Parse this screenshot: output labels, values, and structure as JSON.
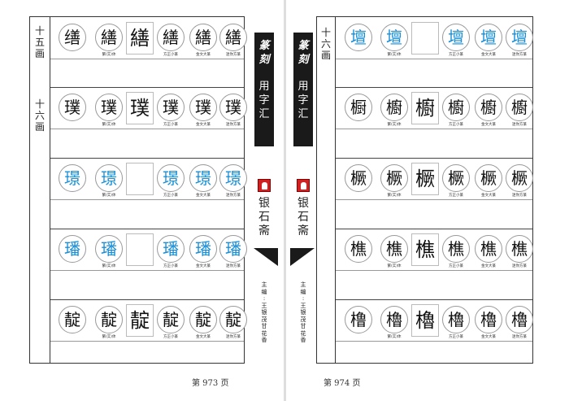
{
  "left": {
    "page_label": "第 973 页",
    "sections": [
      {
        "label": [
          "十",
          "五",
          "画"
        ]
      },
      {
        "label": [
          "十",
          "六",
          "画"
        ]
      }
    ],
    "rows": [
      {
        "chars": [
          "缮",
          "繕",
          "繕",
          "繕",
          "繕",
          "繕"
        ],
        "captions": [
          "繁(实)体",
          "方正小篆",
          "金文大篆",
          "迷你方篆"
        ],
        "blue": false
      },
      {
        "chars": [
          "璞",
          "璞",
          "璞",
          "璞",
          "璞",
          "璞"
        ],
        "captions": [
          "繁(实)体",
          "方正小篆",
          "金文大篆",
          "迷你方篆"
        ],
        "blue": false
      },
      {
        "chars": [
          "璟",
          "璟",
          "",
          "璟",
          "璟",
          "璟"
        ],
        "captions": [
          "繁(实)体",
          "方正小篆",
          "金文大篆",
          "迷你方篆"
        ],
        "blue": true
      },
      {
        "chars": [
          "璠",
          "璠",
          "",
          "璠",
          "璠",
          "璠"
        ],
        "captions": [
          "繁(实)体",
          "方正小篆",
          "金文大篆",
          "迷你方篆"
        ],
        "blue": true
      },
      {
        "chars": [
          "靛",
          "靛",
          "靛",
          "靛",
          "靛",
          "靛"
        ],
        "captions": [
          "繁(实)体",
          "方正小篆",
          "金文大篆",
          "迷你方篆"
        ],
        "blue": false
      }
    ]
  },
  "right": {
    "page_label": "第 974 页",
    "sections": [
      {
        "label": [
          "十",
          "六",
          "画"
        ]
      }
    ],
    "rows": [
      {
        "chars": [
          "壇",
          "壇",
          "",
          "壇",
          "壇",
          "壇"
        ],
        "captions": [
          "繁(实)体",
          "方正小篆",
          "金文大篆",
          "迷你方篆"
        ],
        "blue": true
      },
      {
        "chars": [
          "橱",
          "櫥",
          "櫥",
          "櫥",
          "櫥",
          "櫥"
        ],
        "captions": [
          "繁(实)体",
          "方正小篆",
          "金文大篆",
          "迷你方篆"
        ],
        "blue": false
      },
      {
        "chars": [
          "橛",
          "橛",
          "橛",
          "橛",
          "橛",
          "橛"
        ],
        "captions": [
          "繁(实)体",
          "方正小篆",
          "金文大篆",
          "迷你方篆"
        ],
        "blue": false
      },
      {
        "chars": [
          "樵",
          "樵",
          "樵",
          "樵",
          "樵",
          "樵"
        ],
        "captions": [
          "繁(实)体",
          "方正小篆",
          "金文大篆",
          "迷你方篆"
        ],
        "blue": false
      },
      {
        "chars": [
          "橹",
          "櫓",
          "櫓",
          "櫓",
          "櫓",
          "櫓"
        ],
        "captions": [
          "繁(实)体",
          "方正小篆",
          "金文大篆",
          "迷你方篆"
        ],
        "blue": false
      }
    ]
  },
  "spine": {
    "title_script": [
      "篆",
      "刻"
    ],
    "title_main": [
      "用",
      "字",
      "汇"
    ],
    "publisher": [
      "银",
      "石",
      "斋"
    ],
    "editor": [
      "主",
      "编",
      ":",
      "王",
      "银",
      "茂",
      "",
      "甘",
      "花",
      "香"
    ]
  },
  "colors": {
    "blue": "#1a8fd6",
    "dark": "#1a1a1a",
    "seal": "#d12020"
  }
}
